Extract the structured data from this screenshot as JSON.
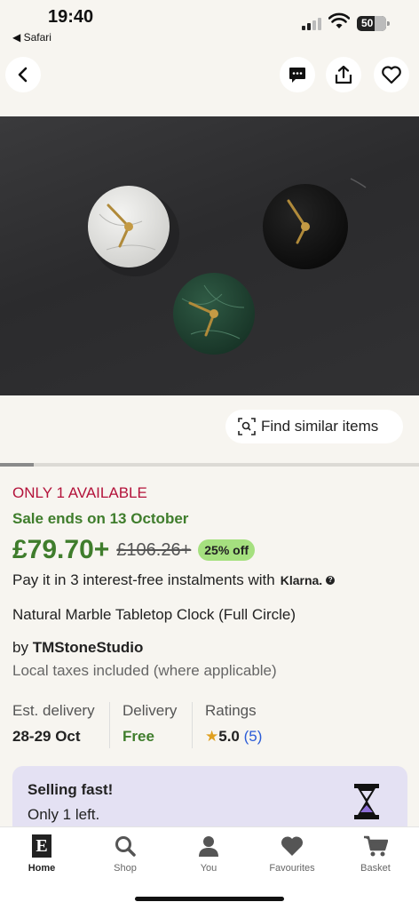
{
  "status_bar": {
    "time": "19:40",
    "back_app": "◀ Safari",
    "battery": "50"
  },
  "product": {
    "availability": "ONLY 1 AVAILABLE",
    "sale_ends": "Sale ends on 13 October",
    "price": "£79.70+",
    "original_price": "£106.26+",
    "discount": "25% off",
    "instalments_text": "Pay it in 3 interest-free instalments with",
    "instalments_provider": "Klarna.",
    "title": "Natural Marble Tabletop Clock (Full Circle)",
    "shop_prefix": "by",
    "shop_name": "TMStoneStudio",
    "taxes_note": "Local taxes included (where applicable)"
  },
  "find_similar_label": "Find similar items",
  "image_carousel": {
    "progress": 0.08
  },
  "info": {
    "est_delivery_label": "Est. delivery",
    "est_delivery_value": "28-29 Oct",
    "delivery_label": "Delivery",
    "delivery_value": "Free",
    "ratings_label": "Ratings",
    "rating_value": "5.0",
    "rating_count": "(5)"
  },
  "selling_fast": {
    "title": "Selling fast!",
    "subtitle": "Only 1 left."
  },
  "tabs": [
    {
      "label": "Home",
      "icon": "etsy-logo-icon",
      "active": true
    },
    {
      "label": "Shop",
      "icon": "search-icon",
      "active": false
    },
    {
      "label": "You",
      "icon": "person-icon",
      "active": false
    },
    {
      "label": "Favourites",
      "icon": "heart-icon",
      "active": false
    },
    {
      "label": "Basket",
      "icon": "cart-icon",
      "active": false
    }
  ],
  "colors": {
    "accent_green": "#3f7d2c",
    "alert_red": "#b3123a",
    "discount_badge": "#a5e07f",
    "rating_link": "#2a5bd7",
    "selling_card": "#e4e1f3"
  }
}
